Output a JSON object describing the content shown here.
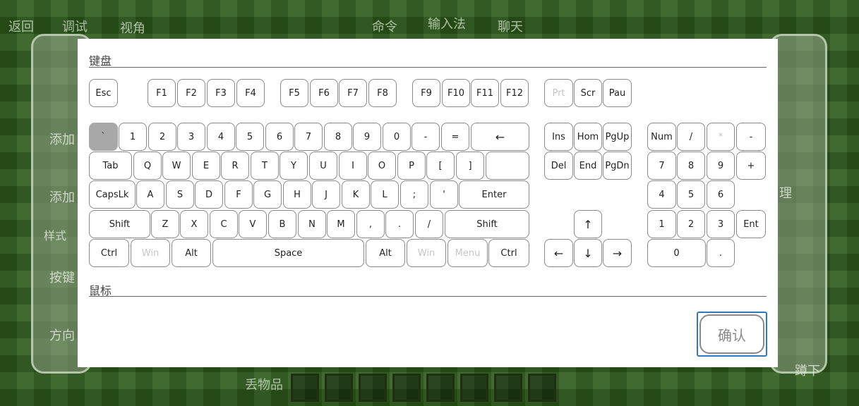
{
  "background": {
    "top_buttons": [
      "返回",
      "调试",
      "视角",
      "命令",
      "输入法",
      "聊天"
    ],
    "left_labels": [
      "添加",
      "添加",
      "样式",
      "按键",
      "方向"
    ],
    "bottom_label": "丢物品",
    "right_labels": [
      "理",
      "蹲下"
    ]
  },
  "keyboard": {
    "title": "键盘",
    "rows": {
      "fn": [
        "Esc",
        "F1",
        "F2",
        "F3",
        "F4",
        "F5",
        "F6",
        "F7",
        "F8",
        "F9",
        "F10",
        "F11",
        "F12",
        "Prt",
        "Scr",
        "Pau"
      ],
      "num": [
        "`",
        "1",
        "2",
        "3",
        "4",
        "5",
        "6",
        "7",
        "8",
        "9",
        "0",
        "-",
        "=",
        "←"
      ],
      "q": [
        "Tab",
        "Q",
        "W",
        "E",
        "R",
        "T",
        "Y",
        "U",
        "I",
        "O",
        "P",
        "[",
        "]",
        ""
      ],
      "a": [
        "CapsLk",
        "A",
        "S",
        "D",
        "F",
        "G",
        "H",
        "J",
        "K",
        "L",
        ";",
        "'",
        "Enter"
      ],
      "z": [
        "Shift",
        "Z",
        "X",
        "C",
        "V",
        "B",
        "N",
        "M",
        ",",
        ".",
        "/",
        "Shift"
      ],
      "bottom": [
        "Ctrl",
        "Win",
        "Alt",
        "Space",
        "Alt",
        "Win",
        "Menu",
        "Ctrl"
      ],
      "nav1": [
        "Ins",
        "Hom",
        "PgUp"
      ],
      "nav2": [
        "Del",
        "End",
        "PgDn"
      ],
      "arrows": [
        "↑",
        "←",
        "↓",
        "→"
      ],
      "numpad1": [
        "Num",
        "/",
        "*",
        "-"
      ],
      "numpad2": [
        "7",
        "8",
        "9",
        "+"
      ],
      "numpad3": [
        "4",
        "5",
        "6"
      ],
      "numpad4": [
        "1",
        "2",
        "3",
        "Ent"
      ],
      "numpad5": [
        "0",
        "."
      ]
    }
  },
  "mouse": {
    "title": "鼠标"
  },
  "confirm": {
    "label": "确认"
  }
}
